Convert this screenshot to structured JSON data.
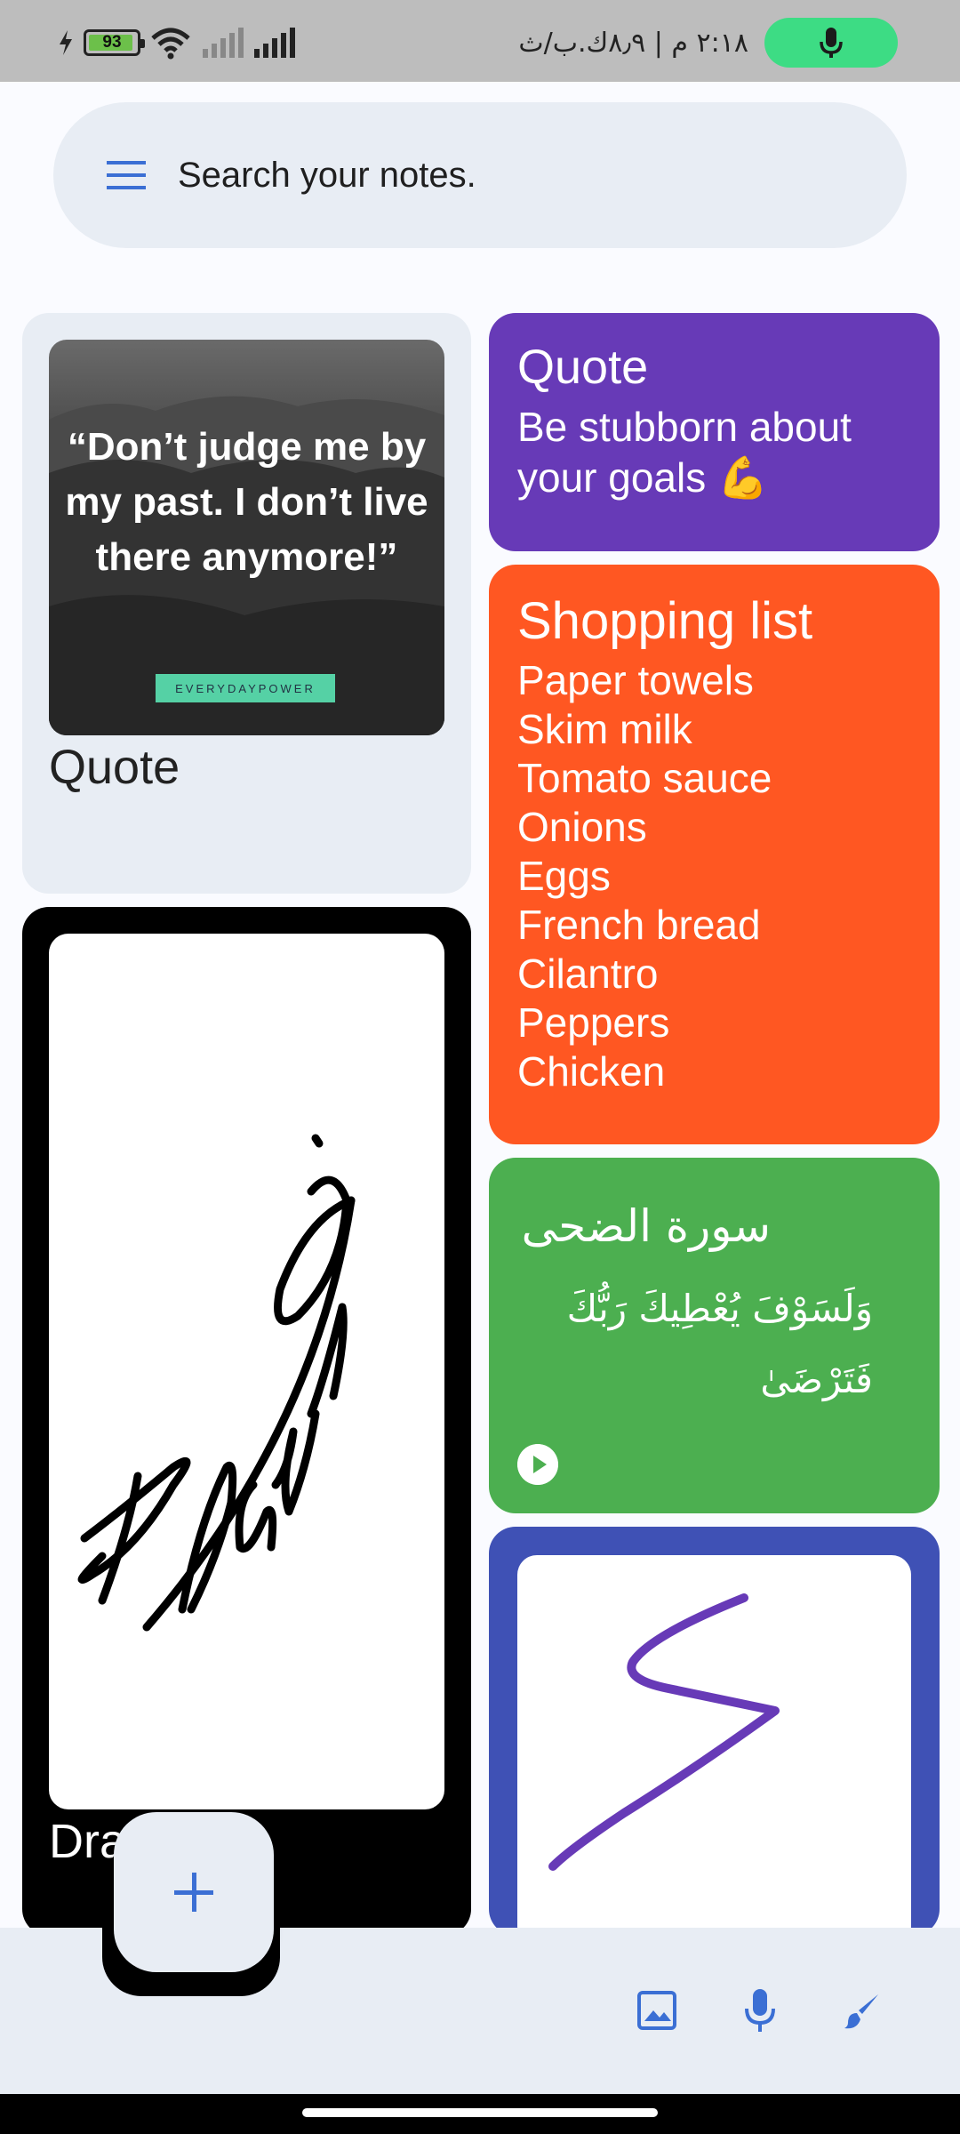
{
  "status_bar": {
    "battery_level": "93",
    "time_text": "٢:١٨ م | ٨٫٩ك.ب/ث",
    "colors": {
      "background": "#bdbdbd",
      "mic_pill": "#3ddc84",
      "battery_fill": "#6cc04a"
    }
  },
  "search": {
    "placeholder": "Search your notes."
  },
  "notes": [
    {
      "type": "image",
      "title": "Quote",
      "image_text": "“Don’t judge me by my past. I don’t live there anymore!”",
      "image_brand": "EVERYDAYPOWER",
      "color": "#e8edf4"
    },
    {
      "type": "text",
      "title": "Quote",
      "body": "Be stubborn about your goals 💪",
      "color": "#673ab7"
    },
    {
      "type": "list",
      "title": "Shopping list",
      "items": [
        "Paper towels",
        "Skim milk",
        "Tomato sauce",
        "Onions",
        "Eggs",
        "French bread",
        "Cilantro",
        "Peppers",
        "Chicken"
      ],
      "color": "#ff5722"
    },
    {
      "type": "audio",
      "title": "سورة الضحى",
      "body": "وَلَسَوْفَ يُعْطِيكَ رَبُّكَ فَتَرْضَىٰ",
      "color": "#4caf50"
    },
    {
      "type": "drawing",
      "title": "Dra",
      "drawing_word": "Drawing",
      "color": "#000000"
    },
    {
      "type": "drawing",
      "title": "",
      "color": "#3f51b5",
      "stroke_color": "#673ab7"
    }
  ],
  "bottom_bar": {
    "fab_icon": "plus-icon",
    "actions": [
      "image-icon",
      "mic-icon",
      "brush-icon"
    ],
    "accent": "#3b6fd4"
  }
}
